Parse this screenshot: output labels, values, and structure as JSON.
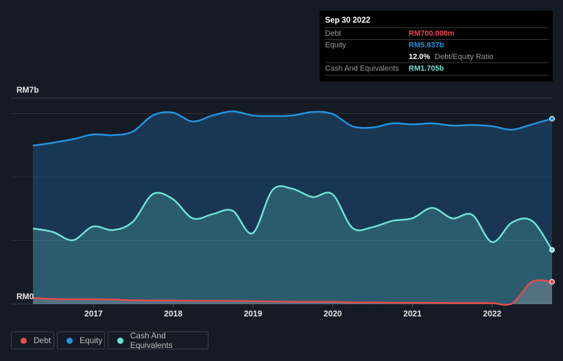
{
  "tooltip": {
    "date": "Sep 30 2022",
    "debt_label": "Debt",
    "debt_value": "RM700.000m",
    "equity_label": "Equity",
    "equity_value": "RM5.837b",
    "ratio_value": "12.0%",
    "ratio_label": "Debt/Equity Ratio",
    "cash_label": "Cash And Equivalents",
    "cash_value": "RM1.705b"
  },
  "legend": [
    {
      "label": "Debt",
      "color": "#e84a4f"
    },
    {
      "label": "Equity",
      "color": "#2394df"
    },
    {
      "label": "Cash And Equivalents",
      "color": "#6ee3d3"
    }
  ],
  "chart_data": {
    "type": "area",
    "y_top_label": "RM7b",
    "y_bottom_label": "RM0",
    "ylim": [
      0,
      7
    ],
    "xlim": [
      2016.24,
      2022.75
    ],
    "x_ticks": [
      "2017",
      "2018",
      "2019",
      "2020",
      "2021",
      "2022"
    ],
    "grid": true,
    "x": [
      "2016-03",
      "2016-06",
      "2016-09",
      "2016-12",
      "2017-03",
      "2017-06",
      "2017-09",
      "2017-12",
      "2018-03",
      "2018-06",
      "2018-09",
      "2018-12",
      "2019-03",
      "2019-06",
      "2019-09",
      "2019-12",
      "2020-03",
      "2020-06",
      "2020-09",
      "2020-12",
      "2021-03",
      "2021-06",
      "2021-09",
      "2021-12",
      "2022-03",
      "2022-06",
      "2022-09"
    ],
    "series": [
      {
        "name": "Equity",
        "color": "#2394df",
        "values": [
          4.99,
          5.08,
          5.19,
          5.34,
          5.32,
          5.43,
          5.94,
          6.03,
          5.75,
          5.94,
          6.07,
          5.94,
          5.92,
          5.94,
          6.05,
          5.99,
          5.6,
          5.56,
          5.69,
          5.66,
          5.69,
          5.62,
          5.64,
          5.6,
          5.49,
          5.66,
          5.837
        ]
      },
      {
        "name": "Cash And Equivalents",
        "color": "#6ee3d3",
        "values": [
          2.38,
          2.27,
          2.01,
          2.44,
          2.33,
          2.59,
          3.46,
          3.31,
          2.7,
          2.83,
          2.94,
          2.23,
          3.59,
          3.63,
          3.37,
          3.46,
          2.4,
          2.42,
          2.62,
          2.7,
          3.03,
          2.7,
          2.81,
          1.95,
          2.57,
          2.62,
          1.705
        ]
      },
      {
        "name": "Debt",
        "color": "#e84a4f",
        "values": [
          0.19,
          0.16,
          0.15,
          0.15,
          0.14,
          0.12,
          0.11,
          0.11,
          0.1,
          0.1,
          0.1,
          0.09,
          0.08,
          0.07,
          0.07,
          0.07,
          0.05,
          0.05,
          0.04,
          0.04,
          0.04,
          0.03,
          0.03,
          0.03,
          0.02,
          0.7,
          0.7
        ]
      }
    ]
  }
}
